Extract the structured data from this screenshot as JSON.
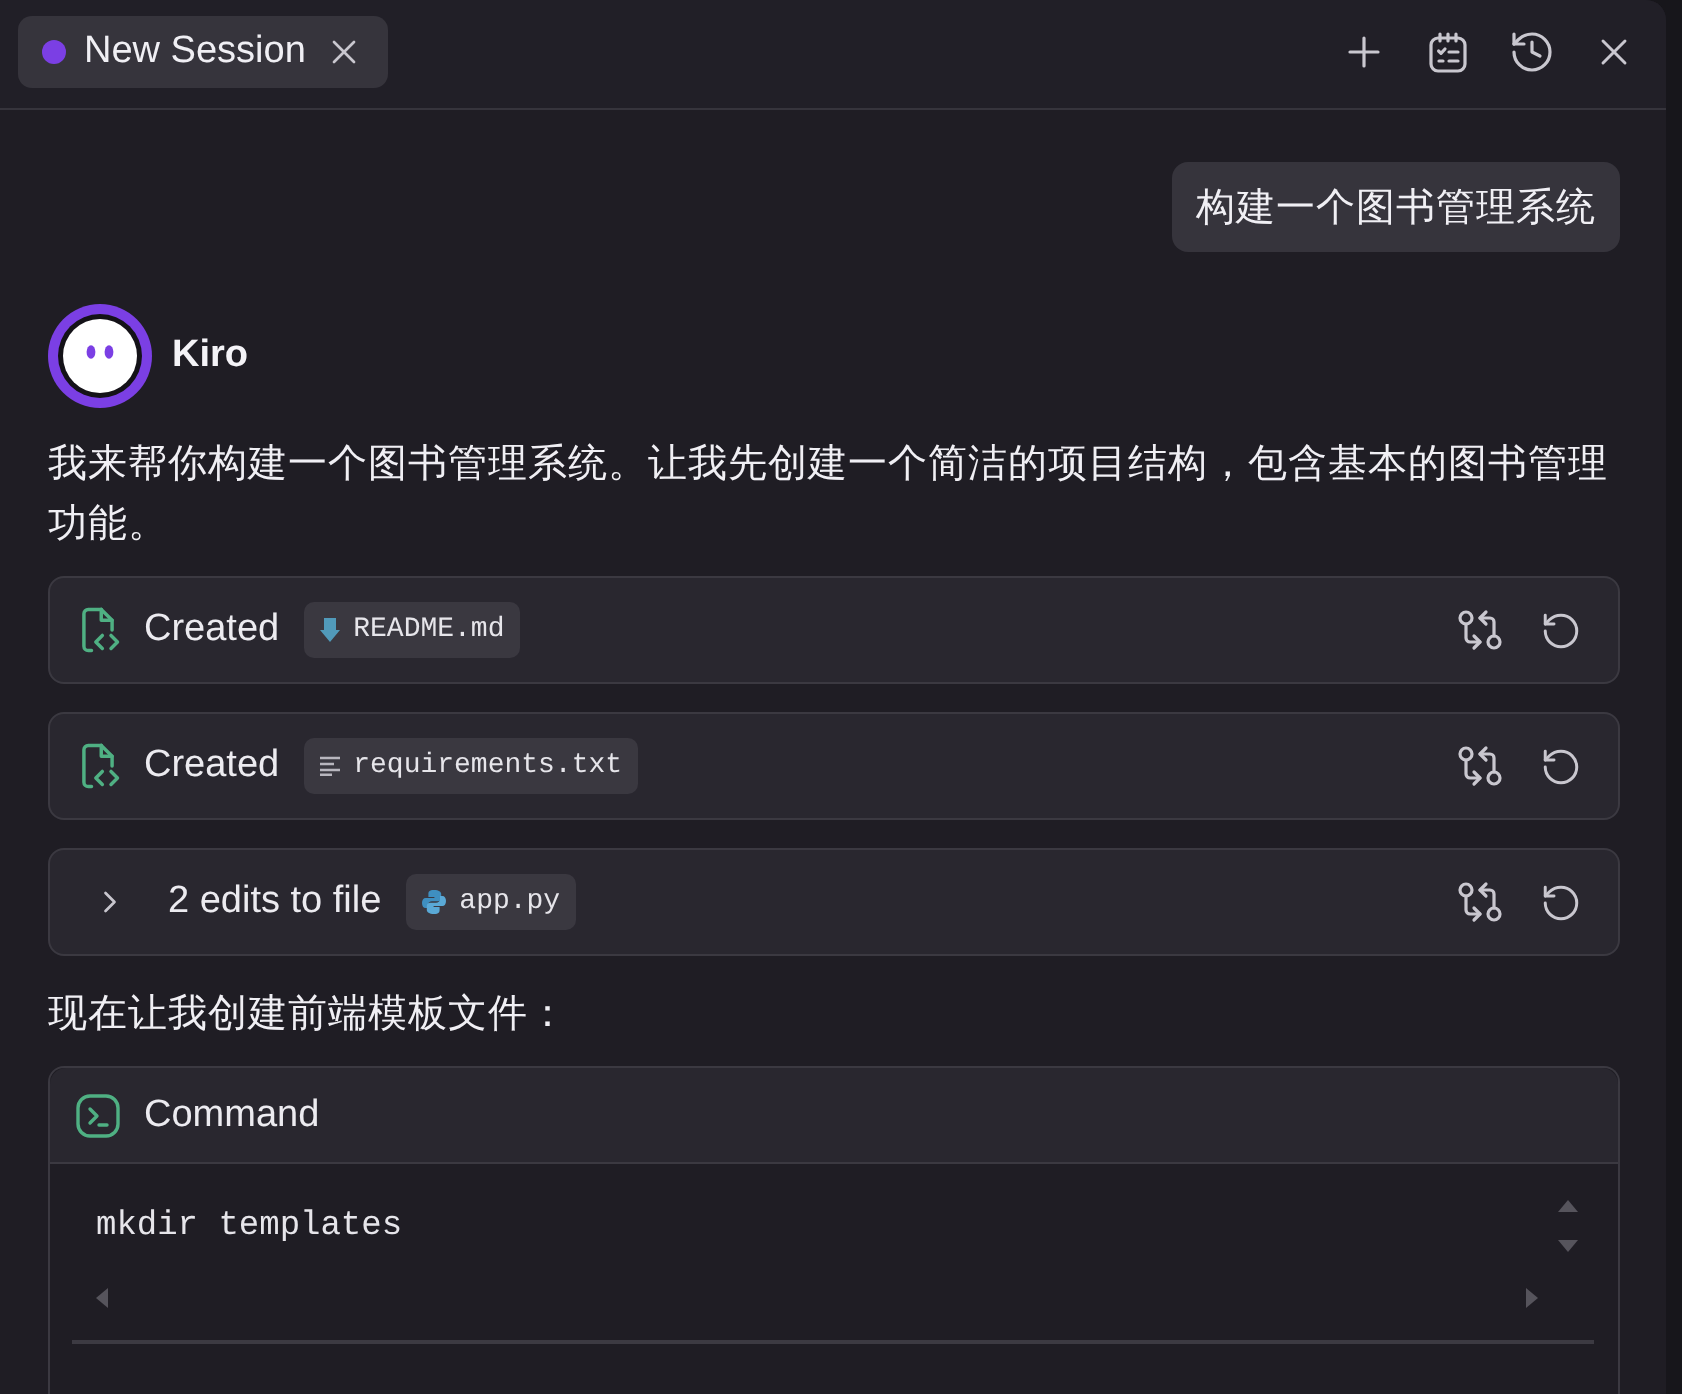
{
  "tabs": [
    {
      "label": "New Session",
      "selected": true
    }
  ],
  "conversation": {
    "user_message": "构建一个图书管理系统",
    "assistant": {
      "name": "Kiro",
      "text": "我来帮你构建一个图书管理系统。让我先创建一个简洁的项目结构，包含基本的图书管理功能。"
    }
  },
  "steps": [
    {
      "kind": "created",
      "action": "Created",
      "file": {
        "name": "README.md",
        "kind": "markdown"
      }
    },
    {
      "kind": "created",
      "action": "Created",
      "file": {
        "name": "requirements.txt",
        "kind": "text"
      }
    },
    {
      "kind": "edits",
      "action": "2 edits to file",
      "expanded": false,
      "file": {
        "name": "app.py",
        "kind": "python"
      }
    }
  ],
  "followup_text": "现在让我创建前端模板文件：",
  "command": {
    "title": "Command",
    "code": "mkdir templates"
  }
}
